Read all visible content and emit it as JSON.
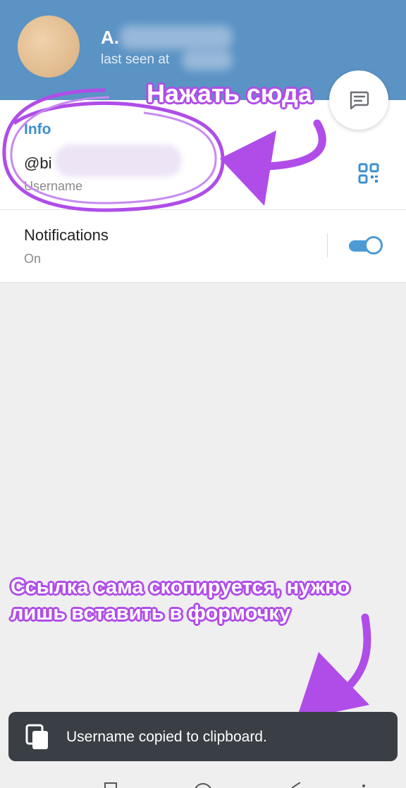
{
  "header": {
    "name": "A.",
    "status": "last seen at",
    "avatar_icon": "avatar-image",
    "chat_button_icon": "message-icon"
  },
  "info": {
    "section_title": "Info",
    "username_value": "@bi",
    "username_label": "Username",
    "qr_icon": "qr-code-icon"
  },
  "notifications": {
    "title": "Notifications",
    "status": "On",
    "enabled": true
  },
  "annotations": {
    "top_hint": "Нажать сюда",
    "bottom_hint": "Ссылка сама скопируется, нужно лишь вставить в формочку"
  },
  "toast": {
    "message": "Username copied to clipboard.",
    "icon": "copy-icon"
  },
  "colors": {
    "header_bg": "#5b93c4",
    "accent": "#3c8fcd",
    "annotation": "#b04de8",
    "toast_bg": "#3a3f45"
  }
}
